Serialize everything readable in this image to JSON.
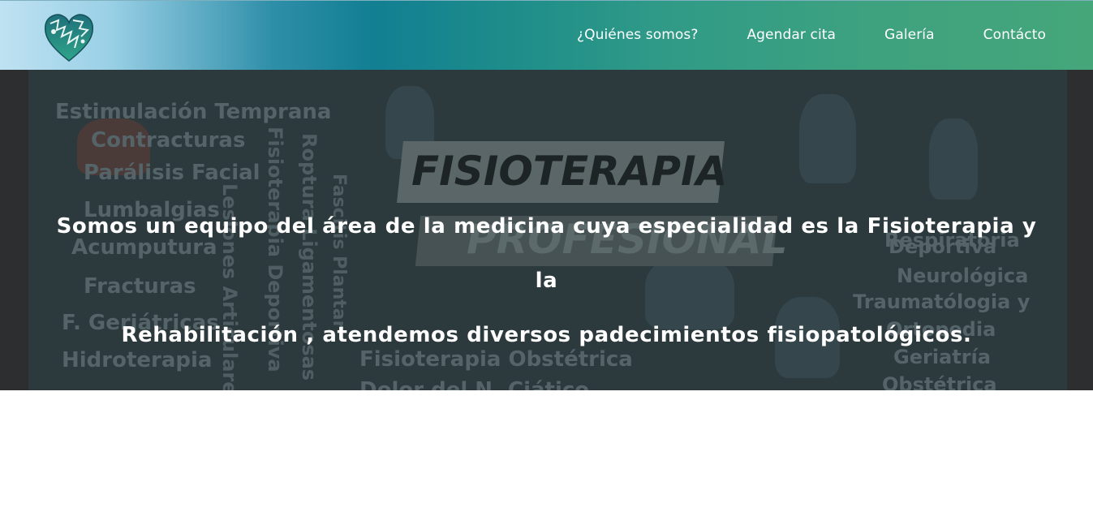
{
  "nav": {
    "logo_icon": "heart-logo-icon",
    "links": [
      {
        "label": "¿Quiénes somos?"
      },
      {
        "label": "Agendar cita"
      },
      {
        "label": "Galería"
      },
      {
        "label": "Contácto"
      }
    ]
  },
  "hero": {
    "headline_line1": "Somos un equipo del área de la medicina cuya especialidad es la Fisioterapia y la",
    "headline_line2": "Rehabilitación , atendemos diversos padecimientos fisiopatológicos.",
    "background_banner": [
      "FISIOTERAPIA",
      "PROFESIONAL"
    ],
    "background_left_words": [
      "Estimulación Temprana",
      "Contracturas",
      "Parálisis Facial",
      "Lumbalgias",
      "Acumputura",
      "Fracturas",
      "F. Geriátricas",
      "Hidroterapia"
    ],
    "background_vertical_words": [
      "Lesiones Articulares",
      "Fisioterapia Deportiva",
      "Roptura Ligamentosas",
      "Fascitis Plantar"
    ],
    "background_bottom_words": [
      "Fisioterapia Obstétrica",
      "Dolor del N. Ciático"
    ],
    "background_right_words": [
      "Respiratoria",
      "Deportiva",
      "Neurológica",
      "Traumatólogia y",
      "Ortopedia",
      "Geriatría",
      "Obstétrica"
    ]
  },
  "colors": {
    "nav_gradient_start": "#bfe2f2",
    "nav_gradient_mid": "#127f93",
    "nav_gradient_end": "#45a67a",
    "hero_overlay": "#2c3a3e",
    "text": "#ffffff"
  }
}
